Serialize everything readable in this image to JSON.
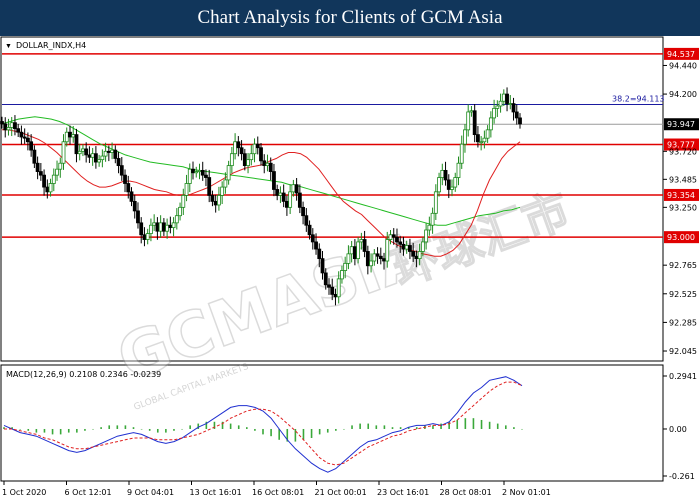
{
  "header": {
    "title": "Chart Analysis for Clients of GCM Asia"
  },
  "watermark": {
    "brand": "GCMASIA",
    "cjk": "环球汇市",
    "tagline": "GLOBAL CAPITAL MARKETS"
  },
  "chart_data": {
    "type": "candlestick",
    "symbol": "DOLLAR_INDX,H4",
    "price_axis": {
      "ticks": [
        "94.440",
        "94.200",
        "93.720",
        "93.485",
        "93.250",
        "92.765",
        "92.525",
        "92.285",
        "92.045"
      ],
      "range": [
        92.02,
        94.62
      ]
    },
    "x_axis": {
      "labels": [
        "1 Oct 2020",
        "6 Oct 12:01",
        "9 Oct 04:01",
        "13 Oct 16:01",
        "16 Oct 08:01",
        "21 Oct 00:01",
        "23 Oct 16:01",
        "28 Oct 08:01",
        "2 Nov 01:01"
      ]
    },
    "levels": [
      {
        "value": 94.537,
        "label": "94.537",
        "color": "#e00000"
      },
      {
        "value": 93.777,
        "label": "93.777",
        "color": "#e00000"
      },
      {
        "value": 93.354,
        "label": "93.354",
        "color": "#e00000"
      },
      {
        "value": 93.0,
        "label": "93.000",
        "color": "#e00000"
      }
    ],
    "fib": {
      "value": 94.113,
      "label": "38.2=94.113",
      "color": "#1a1aa0"
    },
    "current_price": {
      "value": 93.947,
      "label": "93.947"
    },
    "close_series": [
      93.95,
      93.9,
      93.92,
      93.96,
      93.91,
      93.88,
      93.84,
      93.83,
      93.8,
      93.73,
      93.62,
      93.55,
      93.52,
      93.42,
      93.38,
      93.45,
      93.52,
      93.57,
      93.62,
      93.8,
      93.88,
      93.84,
      93.86,
      93.7,
      93.72,
      93.74,
      93.69,
      93.67,
      93.7,
      93.63,
      93.65,
      93.68,
      93.72,
      93.71,
      93.73,
      93.66,
      93.6,
      93.52,
      93.45,
      93.38,
      93.3,
      93.22,
      93.12,
      93.02,
      92.98,
      93.03,
      93.1,
      93.12,
      93.05,
      93.12,
      93.05,
      93.1,
      93.08,
      93.12,
      93.18,
      93.25,
      93.35,
      93.45,
      93.57,
      93.54,
      93.55,
      93.56,
      93.52,
      93.5,
      93.35,
      93.3,
      93.27,
      93.35,
      93.42,
      93.48,
      93.6,
      93.7,
      93.8,
      93.75,
      93.7,
      93.6,
      93.65,
      93.7,
      93.78,
      93.75,
      93.64,
      93.6,
      93.62,
      93.55,
      93.4,
      93.35,
      93.37,
      93.3,
      93.25,
      93.38,
      93.44,
      93.37,
      93.25,
      93.18,
      93.1,
      93.02,
      92.96,
      92.9,
      92.82,
      92.7,
      92.6,
      92.58,
      92.52,
      92.5,
      92.65,
      92.72,
      92.78,
      92.86,
      92.92,
      92.82,
      92.96,
      92.98,
      92.88,
      92.76,
      92.8,
      92.86,
      92.84,
      92.82,
      92.8,
      92.98,
      93.02,
      93.0,
      92.96,
      92.94,
      92.9,
      92.93,
      92.88,
      92.84,
      92.82,
      92.88,
      92.96,
      93.06,
      93.1,
      93.2,
      93.38,
      93.5,
      93.56,
      93.48,
      93.4,
      93.42,
      93.5,
      93.62,
      93.78,
      93.9,
      94.05,
      94.06,
      93.86,
      93.8,
      93.8,
      93.83,
      93.9,
      94.0,
      94.08,
      94.1,
      94.14,
      94.2,
      94.12,
      94.12,
      94.05,
      94.0,
      93.95
    ],
    "ma_red": [
      93.9,
      93.9,
      93.89,
      93.88,
      93.86,
      93.84,
      93.82,
      93.79,
      93.75,
      93.71,
      93.66,
      93.61,
      93.56,
      93.51,
      93.47,
      93.44,
      93.42,
      93.42,
      93.43,
      93.45,
      93.47,
      93.47,
      93.46,
      93.44,
      93.42,
      93.4,
      93.39,
      93.38,
      93.36,
      93.35,
      93.35,
      93.36,
      93.38,
      93.4,
      93.42,
      93.45,
      93.48,
      93.51,
      93.54,
      93.56,
      93.58,
      93.59,
      93.6,
      93.61,
      93.64,
      93.66,
      93.69,
      93.71,
      93.71,
      93.7,
      93.67,
      93.62,
      93.57,
      93.5,
      93.43,
      93.36,
      93.3,
      93.26,
      93.22,
      93.19,
      93.14,
      93.09,
      93.04,
      92.99,
      92.96,
      92.93,
      92.91,
      92.89,
      92.88,
      92.86,
      92.85,
      92.84,
      92.84,
      92.86,
      92.89,
      92.94,
      93.02,
      93.1,
      93.22,
      93.36,
      93.48,
      93.57,
      93.66,
      93.72,
      93.76,
      93.8
    ],
    "ma_green": [
      93.95,
      93.97,
      93.99,
      94.0,
      94.01,
      94.0,
      93.99,
      93.97,
      93.94,
      93.9,
      93.86,
      93.82,
      93.78,
      93.75,
      93.72,
      93.69,
      93.67,
      93.65,
      93.63,
      93.62,
      93.61,
      93.6,
      93.59,
      93.57,
      93.56,
      93.55,
      93.54,
      93.53,
      93.52,
      93.51,
      93.5,
      93.49,
      93.48,
      93.47,
      93.46,
      93.44,
      93.43,
      93.41,
      93.39,
      93.37,
      93.35,
      93.33,
      93.31,
      93.29,
      93.27,
      93.25,
      93.23,
      93.21,
      93.19,
      93.17,
      93.15,
      93.13,
      93.11,
      93.1,
      93.1,
      93.12,
      93.14,
      93.16,
      93.18,
      93.19,
      93.2,
      93.22,
      93.23,
      93.25
    ],
    "macd": {
      "label": "MACD(12,26,9) 0.2108 0.2346 -0.0239",
      "ticks": [
        "0.2941",
        "0.00",
        "-0.261"
      ],
      "range": [
        -0.261,
        0.2941
      ],
      "macd_line": [
        0.02,
        0.0,
        -0.02,
        -0.03,
        -0.04,
        -0.06,
        -0.08,
        -0.1,
        -0.12,
        -0.13,
        -0.12,
        -0.1,
        -0.08,
        -0.06,
        -0.04,
        -0.03,
        -0.02,
        -0.03,
        -0.05,
        -0.07,
        -0.08,
        -0.07,
        -0.05,
        -0.02,
        0.01,
        0.03,
        0.06,
        0.09,
        0.12,
        0.13,
        0.13,
        0.12,
        0.1,
        0.06,
        0.0,
        -0.06,
        -0.11,
        -0.15,
        -0.19,
        -0.22,
        -0.24,
        -0.22,
        -0.18,
        -0.14,
        -0.1,
        -0.07,
        -0.06,
        -0.04,
        -0.02,
        -0.01,
        0.01,
        0.02,
        0.02,
        0.03,
        0.02,
        0.04,
        0.09,
        0.15,
        0.2,
        0.23,
        0.27,
        0.28,
        0.29,
        0.27,
        0.24
      ],
      "signal_line": [
        0.0,
        0.0,
        -0.01,
        -0.02,
        -0.03,
        -0.05,
        -0.06,
        -0.08,
        -0.1,
        -0.11,
        -0.11,
        -0.1,
        -0.09,
        -0.08,
        -0.07,
        -0.06,
        -0.05,
        -0.05,
        -0.05,
        -0.06,
        -0.06,
        -0.06,
        -0.05,
        -0.04,
        -0.03,
        -0.01,
        0.01,
        0.03,
        0.06,
        0.08,
        0.1,
        0.11,
        0.11,
        0.1,
        0.07,
        0.03,
        -0.01,
        -0.06,
        -0.11,
        -0.16,
        -0.19,
        -0.2,
        -0.19,
        -0.16,
        -0.13,
        -0.1,
        -0.08,
        -0.06,
        -0.04,
        -0.03,
        -0.01,
        0.0,
        0.01,
        0.02,
        0.02,
        0.03,
        0.05,
        0.09,
        0.13,
        0.17,
        0.21,
        0.24,
        0.26,
        0.26,
        0.24
      ],
      "histogram": [
        0.01,
        0.01,
        0.0,
        -0.01,
        -0.02,
        -0.02,
        -0.03,
        -0.03,
        -0.02,
        -0.02,
        -0.01,
        0.0,
        0.01,
        0.02,
        0.02,
        0.02,
        0.01,
        0.0,
        -0.01,
        -0.02,
        -0.02,
        -0.01,
        0.0,
        0.02,
        0.03,
        0.04,
        0.04,
        0.04,
        0.03,
        0.02,
        0.01,
        -0.01,
        -0.03,
        -0.04,
        -0.06,
        -0.07,
        -0.07,
        -0.06,
        -0.05,
        -0.03,
        -0.02,
        -0.01,
        0.0,
        0.02,
        0.03,
        0.03,
        0.02,
        0.02,
        0.01,
        0.01,
        0.01,
        0.01,
        0.02,
        0.02,
        0.03,
        0.04,
        0.05,
        0.06,
        0.06,
        0.05,
        0.04,
        0.03,
        0.02,
        0.01,
        0.0
      ]
    },
    "colors": {
      "bull_candle": "#1d8a1d",
      "bear_candle": "#000000",
      "ma_red": "#e02020",
      "ma_green": "#22bb22",
      "macd_line": "#2030d0",
      "signal_line": "#e02020",
      "histogram": "#3aa83a",
      "level_tag_bg": "#e00000",
      "price_tag_bg": "#000000"
    }
  }
}
